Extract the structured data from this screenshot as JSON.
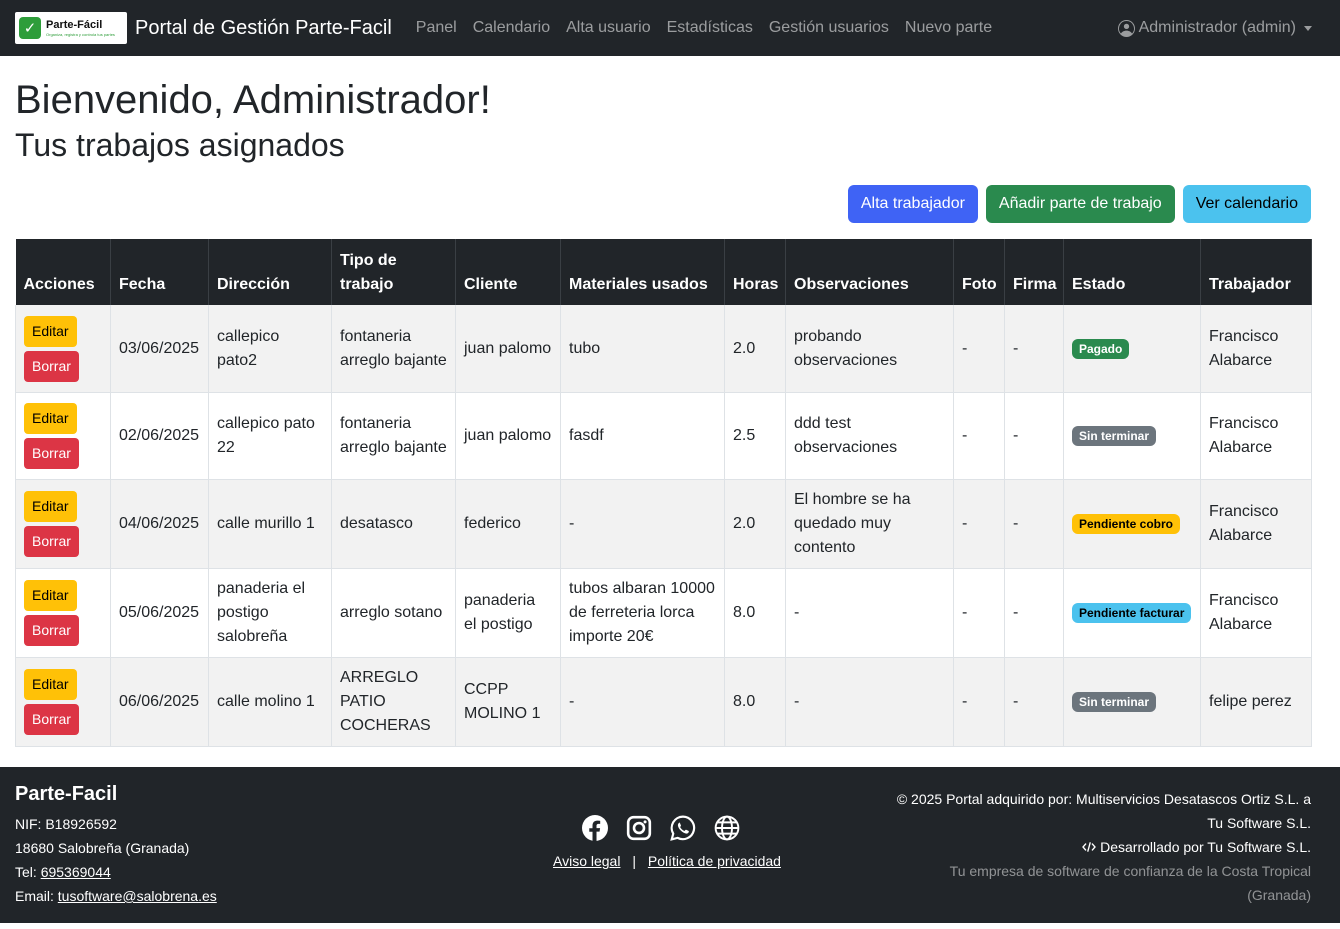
{
  "nav": {
    "logo_name": "Parte-Fácil",
    "logo_tagline": "Organiza, registra y controla tus partes",
    "title": "Portal de Gestión Parte-Facil",
    "links": [
      "Panel",
      "Calendario",
      "Alta usuario",
      "Estadísticas",
      "Gestión usuarios",
      "Nuevo parte"
    ],
    "user": "Administrador (admin)"
  },
  "page": {
    "welcome": "Bienvenido, Administrador!",
    "subtitle": "Tus trabajos asignados"
  },
  "toolbar": {
    "alta_trabajador": "Alta trabajador",
    "anadir_parte": "Añadir parte de trabajo",
    "ver_calendario": "Ver calendario"
  },
  "table": {
    "headers": [
      "Acciones",
      "Fecha",
      "Dirección",
      "Tipo de trabajo",
      "Cliente",
      "Materiales usados",
      "Horas",
      "Observaciones",
      "Foto",
      "Firma",
      "Estado",
      "Trabajador"
    ],
    "edit_label": "Editar",
    "delete_label": "Borrar",
    "rows": [
      {
        "fecha": "03/06/2025",
        "direccion": "callepico pato2",
        "tipo": "fontaneria arreglo bajante",
        "cliente": "juan palomo",
        "materiales": "tubo",
        "horas": "2.0",
        "observaciones": "probando observaciones",
        "foto": "-",
        "firma": "-",
        "estado": "Pagado",
        "trabajador": "Francisco Alabarce"
      },
      {
        "fecha": "02/06/2025",
        "direccion": "callepico pato 22",
        "tipo": "fontaneria arreglo bajante",
        "cliente": "juan palomo",
        "materiales": "fasdf",
        "horas": "2.5",
        "observaciones": "ddd test observaciones",
        "foto": "-",
        "firma": "-",
        "estado": "Sin terminar",
        "trabajador": "Francisco Alabarce"
      },
      {
        "fecha": "04/06/2025",
        "direccion": "calle murillo 1",
        "tipo": "desatasco",
        "cliente": "federico",
        "materiales": "-",
        "horas": "2.0",
        "observaciones": "El hombre se ha quedado muy contento",
        "foto": "-",
        "firma": "-",
        "estado": "Pendiente cobro",
        "trabajador": "Francisco Alabarce"
      },
      {
        "fecha": "05/06/2025",
        "direccion": "panaderia el postigo salobreña",
        "tipo": "arreglo sotano",
        "cliente": "panaderia el postigo",
        "materiales": "tubos albaran 10000 de ferreteria lorca importe 20€",
        "horas": "8.0",
        "observaciones": "-",
        "foto": "-",
        "firma": "-",
        "estado": "Pendiente facturar",
        "trabajador": "Francisco Alabarce"
      },
      {
        "fecha": "06/06/2025",
        "direccion": "calle molino 1",
        "tipo": "ARREGLO PATIO COCHERAS",
        "cliente": "CCPP MOLINO 1",
        "materiales": "-",
        "horas": "8.0",
        "observaciones": "-",
        "foto": "-",
        "firma": "-",
        "estado": "Sin terminar",
        "trabajador": "felipe perez"
      }
    ]
  },
  "status_colors": {
    "Pagado": {
      "bg": "#2a8a4e",
      "fg": "#ffffff"
    },
    "Sin terminar": {
      "bg": "#6c757d",
      "fg": "#ffffff"
    },
    "Pendiente cobro": {
      "bg": "#ffc107",
      "fg": "#000000"
    },
    "Pendiente facturar": {
      "bg": "#4bc2ee",
      "fg": "#000000"
    }
  },
  "footer": {
    "company": "Parte-Facil",
    "nif": "NIF: B18926592",
    "address": "18680 Salobreña (Granada)",
    "tel_label": "Tel: ",
    "tel": "695369044",
    "email_label": "Email: ",
    "email": "tusoftware@salobrena.es",
    "icons": [
      "facebook-icon",
      "instagram-icon",
      "whatsapp-icon",
      "globe-icon"
    ],
    "aviso_legal": "Aviso legal",
    "separator": "|",
    "privacidad": "Política de privacidad",
    "copyright": "© 2025 Portal adquirido por: Multiservicios Desatascos Ortiz S.L. a Tu Software S.L.",
    "developed": "Desarrollado por Tu Software S.L.",
    "tagline": "Tu empresa de software de confianza de la Costa Tropical (Granada)"
  }
}
